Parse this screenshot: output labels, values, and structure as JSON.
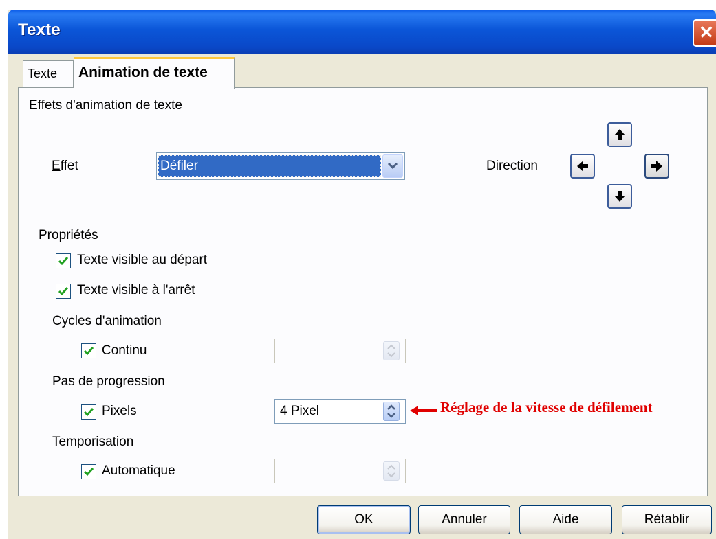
{
  "window": {
    "title": "Texte"
  },
  "tabs": [
    {
      "label": "Texte"
    },
    {
      "label": "Animation de texte"
    }
  ],
  "effects_group": {
    "label": "Effets d'animation de texte",
    "effect_label": "Effet",
    "effect_value": "Défiler",
    "direction_label": "Direction"
  },
  "properties_group": {
    "label": "Propriétés",
    "visible_start": {
      "label": "Texte visible au départ",
      "checked": true
    },
    "visible_stop": {
      "label": "Texte visible à l'arrêt",
      "checked": true
    },
    "cycles": {
      "heading": "Cycles d'animation",
      "checkbox_label": "Continu",
      "checked": true,
      "value": ""
    },
    "increment": {
      "heading": "Pas de progression",
      "checkbox_label": "Pixels",
      "checked": true,
      "value": "4 Pixel"
    },
    "delay": {
      "heading": "Temporisation",
      "checkbox_label": "Automatique",
      "checked": true,
      "value": ""
    }
  },
  "annotation": {
    "text": "Réglage de la vitesse de défilement",
    "color": "#e00000"
  },
  "buttons": {
    "ok": "OK",
    "cancel": "Annuler",
    "help": "Aide",
    "reset": "Rétablir"
  },
  "icons": {
    "close": "close-icon",
    "dropdown": "chevron-down-icon",
    "up": "arrow-up-icon",
    "down": "arrow-down-icon",
    "left": "arrow-left-icon",
    "right": "arrow-right-icon"
  }
}
